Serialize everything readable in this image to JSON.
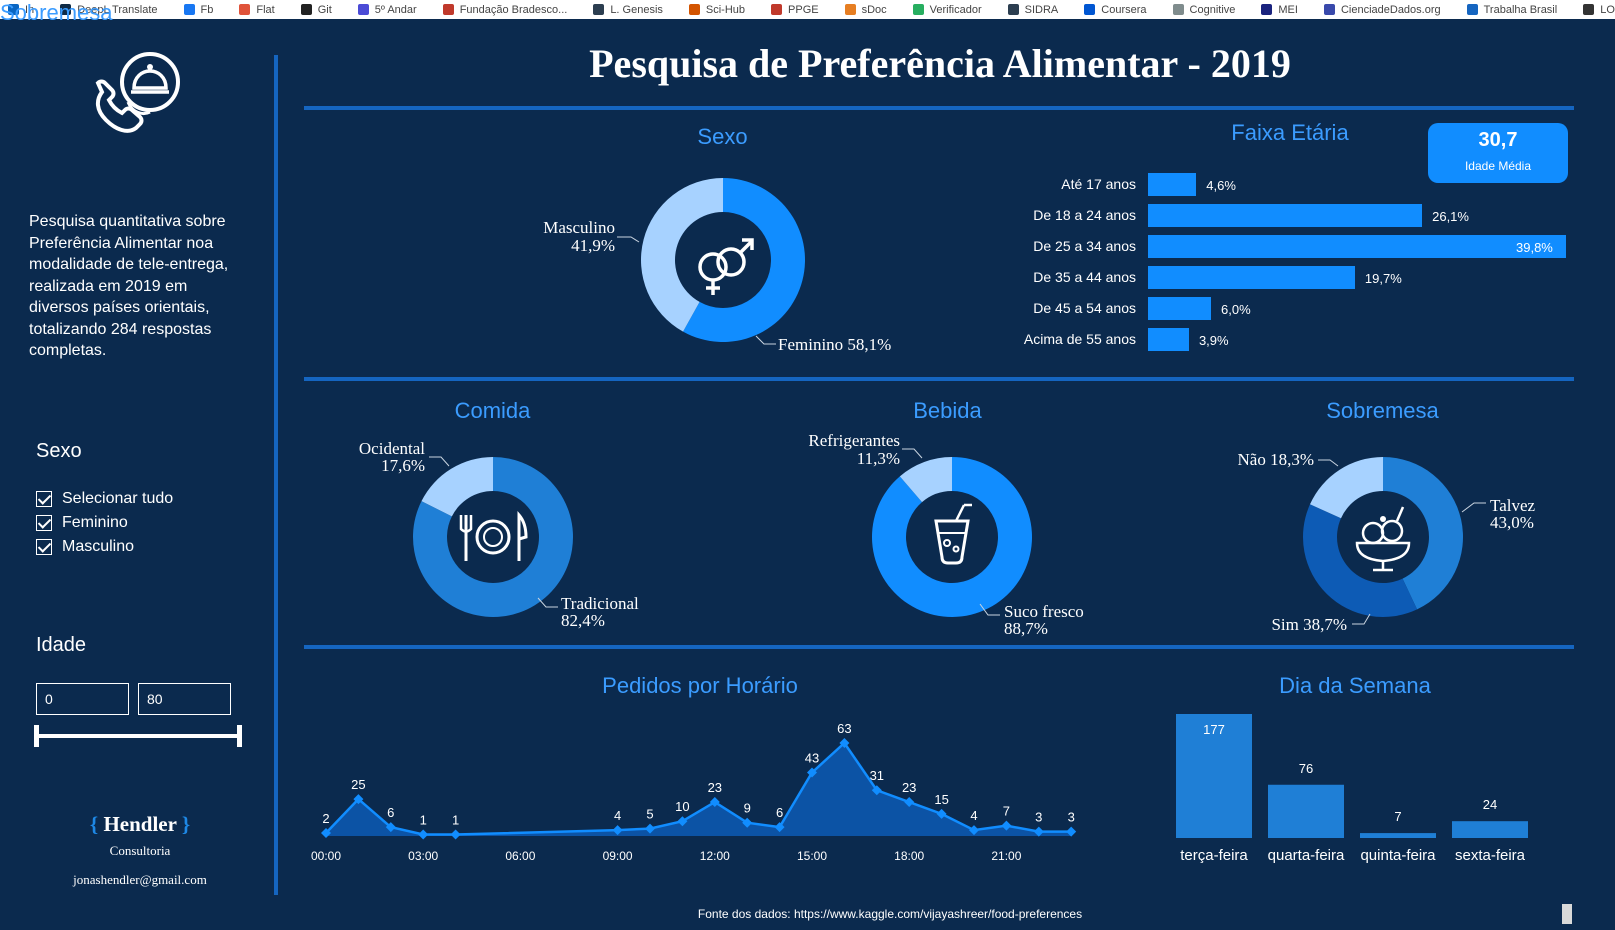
{
  "bookmarks": [
    "In",
    "DeepL Translate",
    "Fb",
    "Flat",
    "Git",
    "5º Andar",
    "Fundação Bradesco...",
    "L. Genesis",
    "Sci-Hub",
    "PPGE",
    "sDoc",
    "Verificador",
    "SIDRA",
    "Coursera",
    "Cognitive",
    "MEI",
    "CienciadeDados.org",
    "Trabalha Brasil",
    "LO"
  ],
  "colors": {
    "background": "#0b2a4e",
    "accent": "#118dff",
    "light": "#a7d2ff",
    "mid": "#1f7fd6",
    "dark": "#0d5bb5",
    "title": "#3b9cff"
  },
  "icons": {
    "logo": "phone-cloche-icon",
    "sexo": "gender-icon",
    "comida": "plate-cutlery-icon",
    "bebida": "drink-icon",
    "sobremesa": "dessert-icon"
  },
  "title": "Pesquisa de Preferência Alimentar - 2019",
  "sidebar": {
    "intro": "Pesquisa quantitativa sobre Preferência Alimentar noa modalidade de tele-entrega, realizada em 2019 em diversos países orientais, totalizando 284 respostas completas.",
    "sexo_filter": {
      "title": "Sexo",
      "options": [
        "Selecionar tudo",
        "Feminino",
        "Masculino"
      ]
    },
    "idade_filter": {
      "title": "Idade",
      "min": "0",
      "max": "80"
    },
    "brand": {
      "name": "Hendler",
      "open": "{",
      "close": "}",
      "sub": "Consultoria",
      "email": "jonashendler@gmail.com"
    }
  },
  "sexo": {
    "title": "Sexo",
    "masculino": "Masculino",
    "masculino_pct": "41,9%",
    "feminino": "Feminino 58,1%"
  },
  "faixa": {
    "title": "Faixa Etária",
    "kpi_value": "30,7",
    "kpi_label": "Idade Média",
    "rows": [
      {
        "label": "Até 17 anos",
        "value": 4.6,
        "text": "4,6%"
      },
      {
        "label": "De 18 a 24 anos",
        "value": 26.1,
        "text": "26,1%"
      },
      {
        "label": "De 25 a 34 anos",
        "value": 39.8,
        "text": "39,8%"
      },
      {
        "label": "De 35 a 44 anos",
        "value": 19.7,
        "text": "19,7%"
      },
      {
        "label": "De 45 a 54 anos",
        "value": 6.0,
        "text": "6,0%"
      },
      {
        "label": "Acima de 55 anos",
        "value": 3.9,
        "text": "3,9%"
      }
    ]
  },
  "comida": {
    "title": "Comida",
    "ocidental": "Ocidental",
    "ocidental_pct": "17,6%",
    "tradicional": "Tradicional",
    "tradicional_pct": "82,4%"
  },
  "bebida": {
    "title": "Bebida",
    "refri": "Refrigerantes",
    "refri_pct": "11,3%",
    "suco": "Suco fresco",
    "suco_pct": "88,7%"
  },
  "sobremesa": {
    "title": "Sobremesa",
    "nao": "Não 18,3%",
    "talvez": "Talvez",
    "talvez_pct": "43,0%",
    "sim": "Sim 38,7%"
  },
  "pedidos": {
    "title": "Pedidos por Horário"
  },
  "dia": {
    "title": "Dia da Semana"
  },
  "source": "Fonte dos dados: https://www.kaggle.com/vijayashreer/food-preferences",
  "chart_data": [
    {
      "type": "pie",
      "title": "Sexo",
      "labels": [
        "Masculino",
        "Feminino"
      ],
      "values": [
        41.9,
        58.1
      ]
    },
    {
      "type": "bar",
      "title": "Faixa Etária",
      "categories": [
        "Até 17 anos",
        "De 18 a 24 anos",
        "De 25 a 34 anos",
        "De 35 a 44 anos",
        "De 45 a 54 anos",
        "Acima de 55 anos"
      ],
      "values": [
        4.6,
        26.1,
        39.8,
        19.7,
        6.0,
        3.9
      ]
    },
    {
      "type": "pie",
      "title": "Comida",
      "labels": [
        "Ocidental",
        "Tradicional"
      ],
      "values": [
        17.6,
        82.4
      ]
    },
    {
      "type": "pie",
      "title": "Bebida",
      "labels": [
        "Refrigerantes",
        "Suco fresco"
      ],
      "values": [
        11.3,
        88.7
      ]
    },
    {
      "type": "pie",
      "title": "Sobremesa",
      "labels": [
        "Não",
        "Talvez",
        "Sim"
      ],
      "values": [
        18.3,
        43.0,
        38.7
      ]
    },
    {
      "type": "area",
      "title": "Pedidos por Horário",
      "x": [
        0,
        1,
        2,
        3,
        4,
        9,
        10,
        11,
        12,
        13,
        14,
        15,
        16,
        17,
        18,
        19,
        20,
        21,
        22,
        23
      ],
      "y": [
        2,
        25,
        6,
        1,
        1,
        4,
        5,
        10,
        23,
        9,
        6,
        43,
        63,
        31,
        23,
        15,
        4,
        7,
        3,
        3
      ],
      "ticks": [
        "00:00",
        "03:00",
        "06:00",
        "09:00",
        "12:00",
        "15:00",
        "18:00",
        "21:00"
      ]
    },
    {
      "type": "bar",
      "title": "Dia da Semana",
      "categories": [
        "terça-feira",
        "quarta-feira",
        "quinta-feira",
        "sexta-feira"
      ],
      "values": [
        177,
        76,
        7,
        24
      ]
    }
  ]
}
